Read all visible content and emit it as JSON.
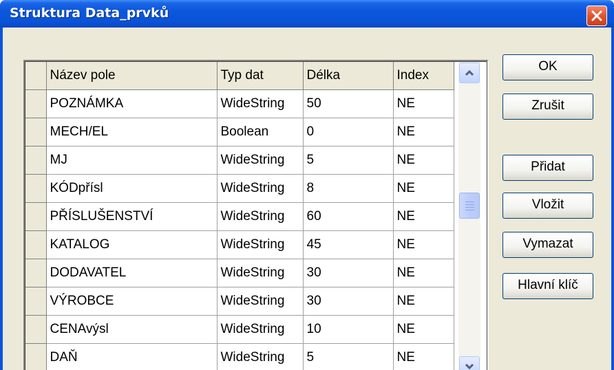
{
  "window": {
    "title": "Struktura Data_prvků"
  },
  "table": {
    "columns": [
      "Název pole",
      "Typ dat",
      "Délka",
      "Index"
    ],
    "rows": [
      [
        "POZNÁMKA",
        "WideString",
        "50",
        "NE"
      ],
      [
        "MECH/EL",
        "Boolean",
        "0",
        "NE"
      ],
      [
        "MJ",
        "WideString",
        "5",
        "NE"
      ],
      [
        "KÓDpřísl",
        "WideString",
        "8",
        "NE"
      ],
      [
        "PŘÍSLUŠENSTVÍ",
        "WideString",
        "60",
        "NE"
      ],
      [
        "KATALOG",
        "WideString",
        "45",
        "NE"
      ],
      [
        "DODAVATEL",
        "WideString",
        "30",
        "NE"
      ],
      [
        "VÝROBCE",
        "WideString",
        "30",
        "NE"
      ],
      [
        "CENAvýsl",
        "WideString",
        "10",
        "NE"
      ],
      [
        "DAŇ",
        "WideString",
        "5",
        "NE"
      ]
    ]
  },
  "buttons": {
    "ok": "OK",
    "cancel": "Zrušit",
    "add": "Přidat",
    "insert": "Vložit",
    "delete": "Vymazat",
    "primary_key": "Hlavní klíč"
  },
  "icons": {
    "close": "close-x-icon",
    "scroll_up": "arrow-up-icon",
    "scroll_down": "arrow-down-icon"
  },
  "colors": {
    "titlebar": "#0a53de",
    "close_button": "#e05530",
    "dialog_face": "#ece9d8",
    "scrollbar_accent": "#c3d3fd"
  }
}
